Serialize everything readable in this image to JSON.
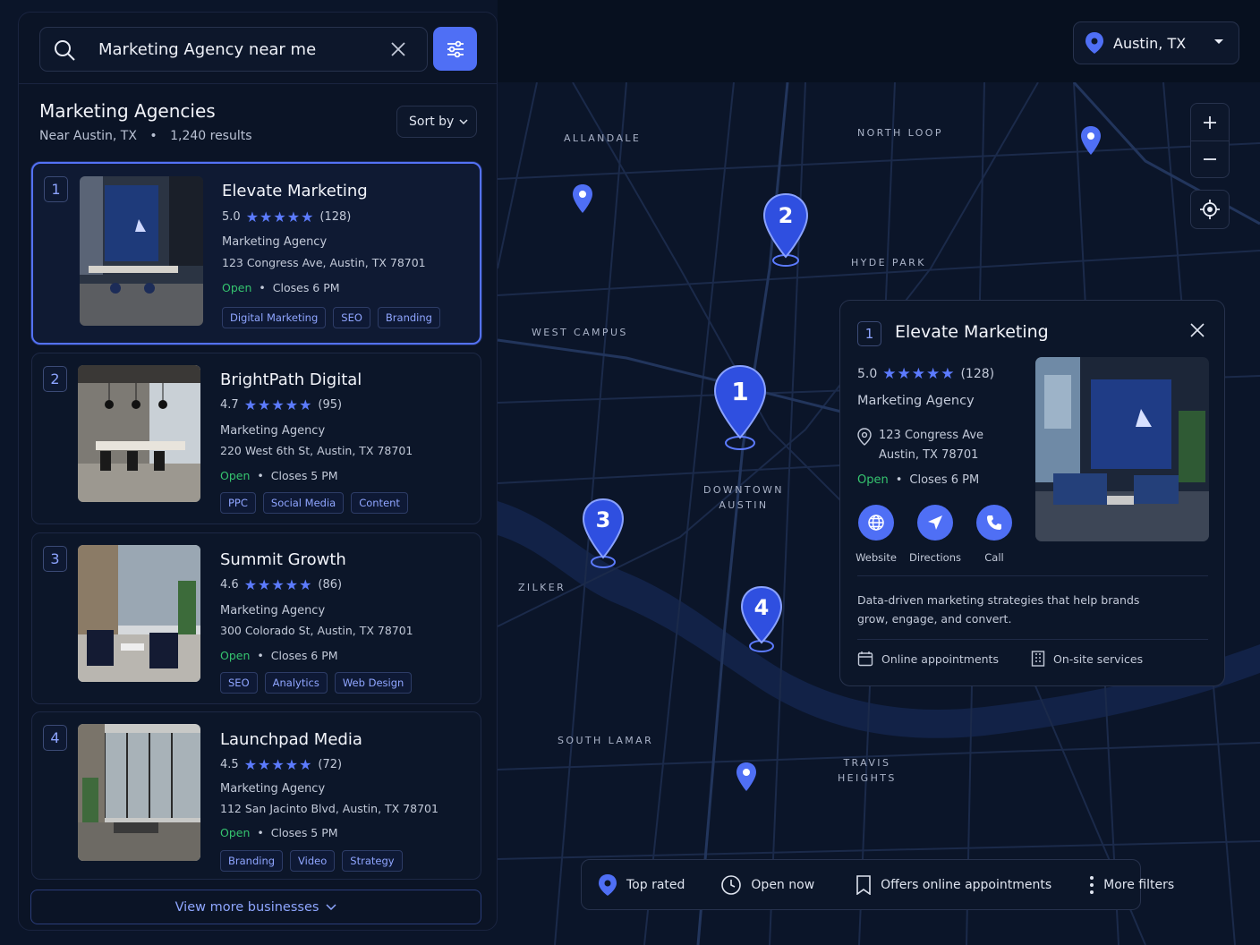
{
  "search": {
    "value": "Marketing Agency near me"
  },
  "list": {
    "title": "Marketing Agencies",
    "location": "Near Austin, TX",
    "separator": "•",
    "results": "1,240 results",
    "sort_label": "Sort by",
    "view_more": "View more businesses"
  },
  "location_select": {
    "value": "Austin, TX"
  },
  "businesses": [
    {
      "num": "1",
      "name": "Elevate Marketing",
      "rating": "5.0",
      "stars": "★★★★★",
      "reviews": "(128)",
      "type": "Marketing Agency",
      "address": "123 Congress Ave, Austin, TX 78701",
      "open": "Open",
      "dot": "•",
      "closes": "Closes 6 PM",
      "tags": [
        "Digital Marketing",
        "SEO",
        "Branding"
      ]
    },
    {
      "num": "2",
      "name": "BrightPath Digital",
      "rating": "4.7",
      "stars": "★★★★★",
      "reviews": "(95)",
      "type": "Marketing Agency",
      "address": "220 West 6th St, Austin, TX 78701",
      "open": "Open",
      "dot": "•",
      "closes": "Closes 5 PM",
      "tags": [
        "PPC",
        "Social Media",
        "Content"
      ]
    },
    {
      "num": "3",
      "name": "Summit Growth",
      "rating": "4.6",
      "stars": "★★★★★",
      "reviews": "(86)",
      "type": "Marketing Agency",
      "address": "300 Colorado St, Austin, TX 78701",
      "open": "Open",
      "dot": "•",
      "closes": "Closes 6 PM",
      "tags": [
        "SEO",
        "Analytics",
        "Web Design"
      ]
    },
    {
      "num": "4",
      "name": "Launchpad Media",
      "rating": "4.5",
      "stars": "★★★★★",
      "reviews": "(72)",
      "type": "Marketing Agency",
      "address": "112 San Jacinto Blvd, Austin, TX 78701",
      "open": "Open",
      "dot": "•",
      "closes": "Closes 5 PM",
      "tags": [
        "Branding",
        "Video",
        "Strategy"
      ]
    }
  ],
  "map": {
    "neighborhoods": [
      "ALLANDALE",
      "NORTH LOOP",
      "HYDE PARK",
      "WEST CAMPUS",
      "DOWNTOWN\nAUSTIN",
      "ZILKER",
      "SOUTH LAMAR",
      "TRAVIS\nHEIGHTS"
    ],
    "pins": [
      "1",
      "2",
      "3",
      "4"
    ],
    "zoom_in": "+",
    "zoom_out": "−"
  },
  "detail": {
    "num": "1",
    "name": "Elevate Marketing",
    "rating": "5.0",
    "stars": "★★★★★",
    "reviews": "(128)",
    "type": "Marketing Agency",
    "address_line1": "123 Congress Ave",
    "address_line2": "Austin, TX 78701",
    "open": "Open",
    "dot": "•",
    "closes": "Closes 6 PM",
    "actions": {
      "website": "Website",
      "directions": "Directions",
      "call": "Call"
    },
    "description": "Data-driven marketing strategies that help brands grow, engage, and convert.",
    "features": {
      "online": "Online appointments",
      "onsite": "On-site services"
    }
  },
  "filters": {
    "top_rated": "Top rated",
    "open_now": "Open now",
    "online": "Offers online appointments",
    "more": "More filters"
  },
  "colors": {
    "accent": "#4f6ff5",
    "open": "#35c46f",
    "background": "#081020"
  }
}
